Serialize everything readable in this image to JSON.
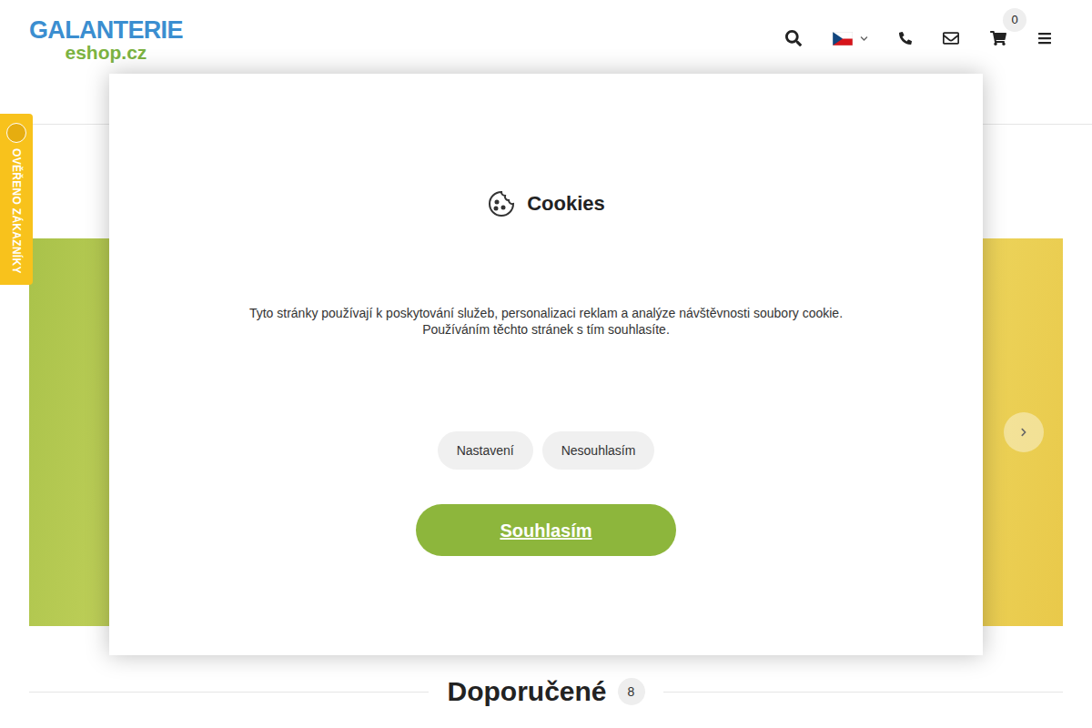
{
  "logo": {
    "top": "GALANTERIE",
    "bottom": "eshop.cz"
  },
  "header": {
    "cart_count": "0"
  },
  "side_badge": {
    "label": "OVĚŘENO ZÁKAZNÍKY"
  },
  "cookie_dialog": {
    "title": "Cookies",
    "text": [
      "Tyto stránky používají k poskytování služeb, personalizaci reklam a analýze návštěvnosti soubory cookie.",
      "Používáním těchto stránek s tím souhlasíte."
    ],
    "buttons": [
      {
        "label": "Nastavení",
        "kind": "secondary"
      },
      {
        "label": "Nesouhlasím",
        "kind": "secondary"
      },
      {
        "label": "Souhlasím",
        "kind": "primary"
      }
    ]
  },
  "section": {
    "title": "Doporučené",
    "count": "8"
  }
}
